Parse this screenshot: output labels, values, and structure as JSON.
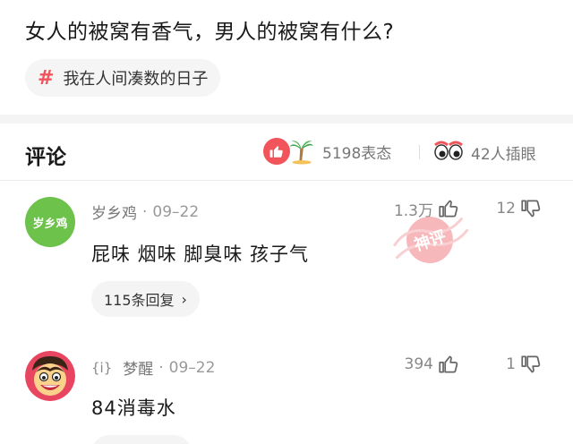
{
  "post": {
    "title": "女人的被窝有香气，男人的被窝有什么?",
    "topic": {
      "hash": "#",
      "label": "我在人间凑数的日子"
    }
  },
  "comments_header": {
    "title": "评论",
    "reactions_count": "5198表态",
    "plug_count": "42人插眼"
  },
  "comments": [
    {
      "avatar_text": "岁乡鸡",
      "username": "岁乡鸡",
      "separator": "·",
      "date": "09–22",
      "text": "屁味 烟味 脚臭味  孩子气",
      "replies_label": "115条回复",
      "replies_chevron": "›",
      "upvotes": "1.3万",
      "downvotes": "12"
    },
    {
      "user_prefix": "{i}",
      "username": "梦醒",
      "separator": "·",
      "date": "09–22",
      "text": "84消毒水",
      "upvotes": "394",
      "downvotes": "1"
    }
  ],
  "stamp_text": "神评",
  "colors": {
    "accent": "#f2545b",
    "avatar_green": "#6cc24a",
    "muted_text": "#888888",
    "pill_bg": "#f4f4f4"
  },
  "icons": [
    "hash-icon",
    "thumb-up-icon",
    "palm-tree-icon",
    "eyes-icon",
    "thumb-down-icon",
    "chevron-right-icon"
  ]
}
